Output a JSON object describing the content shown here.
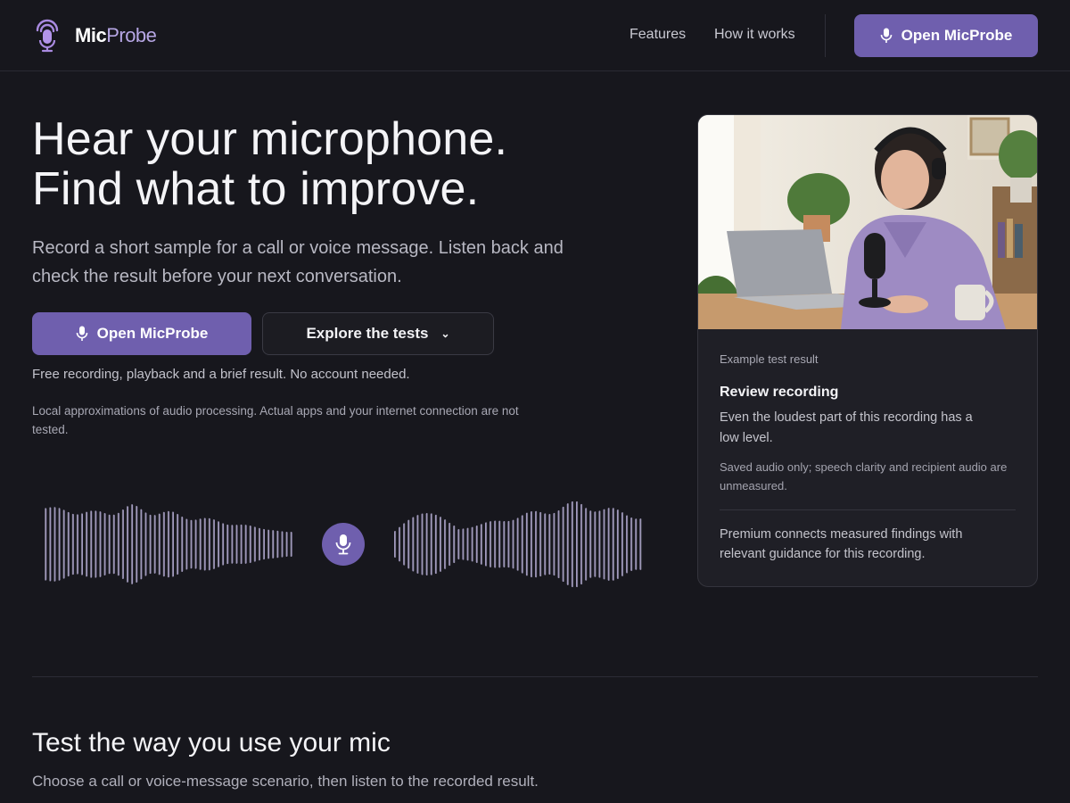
{
  "brand": {
    "name_bold": "Mic",
    "name_light": "Probe",
    "accent": "#6f5fae",
    "logo_color": "#a98ae0"
  },
  "nav": {
    "links": [
      {
        "label": "Features"
      },
      {
        "label": "How it works"
      }
    ],
    "cta_label": "Open MicProbe",
    "cta_icon": "microphone-icon"
  },
  "hero": {
    "title_line1": "Hear your microphone.",
    "title_line2": "Find what to improve.",
    "lead": "Record a short sample for a call or voice message. Listen back and check the result before your next conversation.",
    "primary_label": "Open MicProbe",
    "secondary_label": "Explore the tests",
    "secondary_icon": "chevron-down-icon",
    "note": "Free recording, playback and a brief result. No account needed.",
    "disclaimer": "Local approximations of audio processing. Actual apps and your internet connection are not tested.",
    "record_icon": "microphone-icon"
  },
  "example": {
    "eyebrow": "Example test result",
    "title": "Review recording",
    "text": "Even the loudest part of this recording has a low level.",
    "small": "Saved audio only; speech clarity and recipient audio are unmeasured.",
    "premium": "Premium connects measured findings with relevant guidance for this recording."
  },
  "section": {
    "title": "Test the way you use your mic",
    "subtitle": "Choose a call or voice-message scenario, then listen to the recorded result."
  }
}
